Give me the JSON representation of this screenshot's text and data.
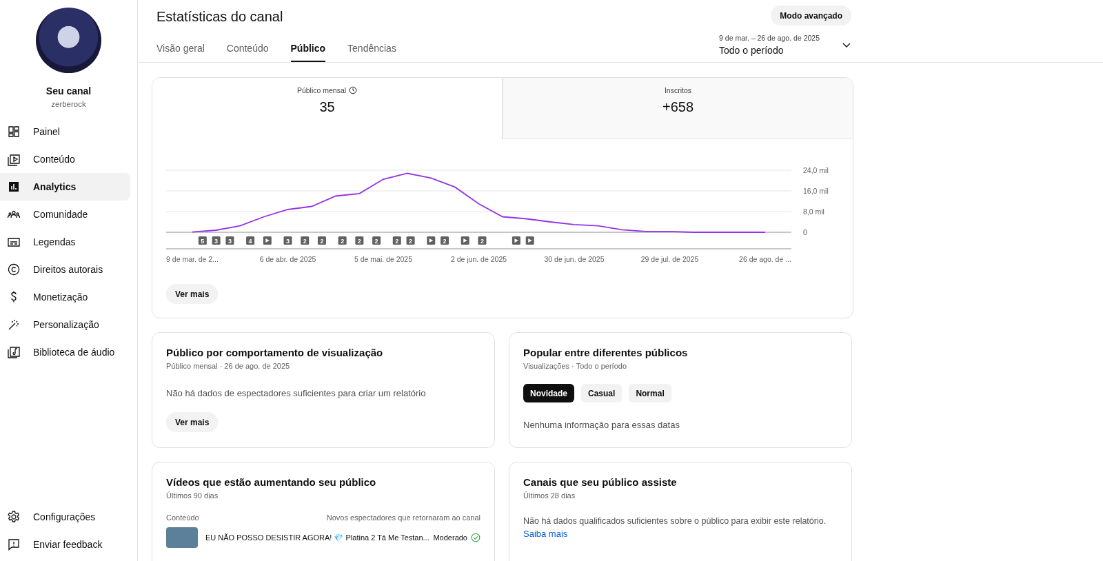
{
  "sidebar": {
    "channel_name": "Seu canal",
    "handle": "zerberock",
    "items": [
      {
        "label": "Painel",
        "selected": false
      },
      {
        "label": "Conteúdo",
        "selected": false
      },
      {
        "label": "Analytics",
        "selected": true
      },
      {
        "label": "Comunidade",
        "selected": false
      },
      {
        "label": "Legendas",
        "selected": false
      },
      {
        "label": "Direitos autorais",
        "selected": false
      },
      {
        "label": "Monetização",
        "selected": false
      },
      {
        "label": "Personalização",
        "selected": false
      },
      {
        "label": "Biblioteca de áudio",
        "selected": false
      }
    ],
    "footer_items": [
      {
        "label": "Configurações"
      },
      {
        "label": "Enviar feedback"
      }
    ]
  },
  "header": {
    "title": "Estatísticas do canal",
    "advanced_button": "Modo avançado",
    "tabs": [
      {
        "label": "Visão geral",
        "selected": false
      },
      {
        "label": "Conteúdo",
        "selected": false
      },
      {
        "label": "Público",
        "selected": true
      },
      {
        "label": "Tendências",
        "selected": false
      }
    ],
    "date_range": {
      "dates": "9 de mar. – 26 de ago. de 2025",
      "period": "Todo o período"
    }
  },
  "overview": {
    "metrics": [
      {
        "label": "Público mensal",
        "value": "35",
        "selected": true,
        "info": true
      },
      {
        "label": "Inscritos",
        "value": "+658",
        "selected": false,
        "info": false
      }
    ],
    "chart_data": {
      "type": "line",
      "categories": [
        "9 de mar. de 2...",
        null,
        null,
        null,
        "6 de abr. de 2025",
        null,
        null,
        null,
        "5 de mai. de 2025",
        null,
        null,
        null,
        "2 de jun. de 2025",
        null,
        null,
        null,
        "30 de jun. de 2025",
        null,
        null,
        null,
        "29 de jul. de 2025",
        null,
        null,
        null,
        "26 de ago. de ..."
      ],
      "values": [
        0.1,
        0.8,
        2.5,
        6,
        8.8,
        10,
        14,
        15,
        20.5,
        22.8,
        21,
        17.5,
        11,
        6,
        5.2,
        4,
        3,
        2.5,
        1,
        0.3,
        0.3,
        0,
        0,
        0,
        0
      ],
      "ylim": [
        0,
        24
      ],
      "yticks": [
        {
          "value": 0,
          "label": "0"
        },
        {
          "value": 8,
          "label": "8,0 mil"
        },
        {
          "value": 16,
          "label": "16,0 mil"
        },
        {
          "value": 24,
          "label": "24,0 mil"
        }
      ]
    },
    "markers": [
      {
        "kind": "count",
        "label": "5"
      },
      {
        "kind": "count",
        "label": "3"
      },
      {
        "kind": "count",
        "label": "3"
      },
      {
        "kind": "count",
        "label": "4"
      },
      {
        "kind": "video"
      },
      {
        "kind": "count",
        "label": "3"
      },
      {
        "kind": "count",
        "label": "2"
      },
      {
        "kind": "count",
        "label": "2"
      },
      {
        "kind": "count",
        "label": "2"
      },
      {
        "kind": "count",
        "label": "2"
      },
      {
        "kind": "count",
        "label": "2"
      },
      {
        "kind": "count",
        "label": "2"
      },
      {
        "kind": "count",
        "label": "2"
      },
      {
        "kind": "video"
      },
      {
        "kind": "count",
        "label": "2"
      },
      {
        "kind": "video"
      },
      {
        "kind": "count",
        "label": "2"
      },
      {
        "kind": "video"
      },
      {
        "kind": "video"
      }
    ],
    "more_button": "Ver mais"
  },
  "cards": [
    {
      "kind": "empty",
      "title": "Público por comportamento de visualização",
      "subtitle": "Público mensal · 26 de ago. de 2025",
      "message": "Não há dados de espectadores suficientes para criar um relatório",
      "button": "Ver mais"
    },
    {
      "kind": "chips",
      "title": "Popular entre diferentes públicos",
      "subtitle": "Visualizações · Todo o período",
      "chips": [
        {
          "label": "Novidade",
          "selected": true
        },
        {
          "label": "Casual",
          "selected": false
        },
        {
          "label": "Normal",
          "selected": false
        }
      ],
      "message": "Nenhuma informação para essas datas"
    },
    {
      "kind": "table",
      "title": "Vídeos que estão aumentando seu público",
      "subtitle": "Últimos 90 dias",
      "columns": [
        "Conteúdo",
        "Novos espectadores que retornaram ao canal"
      ],
      "rows": [
        {
          "title": "EU NÃO POSSO DESISTIR AGORA! 💎 Platina 2 Tá Me Testan...",
          "level_text": "Moderado",
          "ok": true
        }
      ]
    },
    {
      "kind": "link",
      "title": "Canais que seu público assiste",
      "subtitle": "Últimos 28 dias",
      "message": "Não há dados qualificados suficientes sobre o público para exibir este relatório.",
      "link": "Saiba mais"
    }
  ]
}
